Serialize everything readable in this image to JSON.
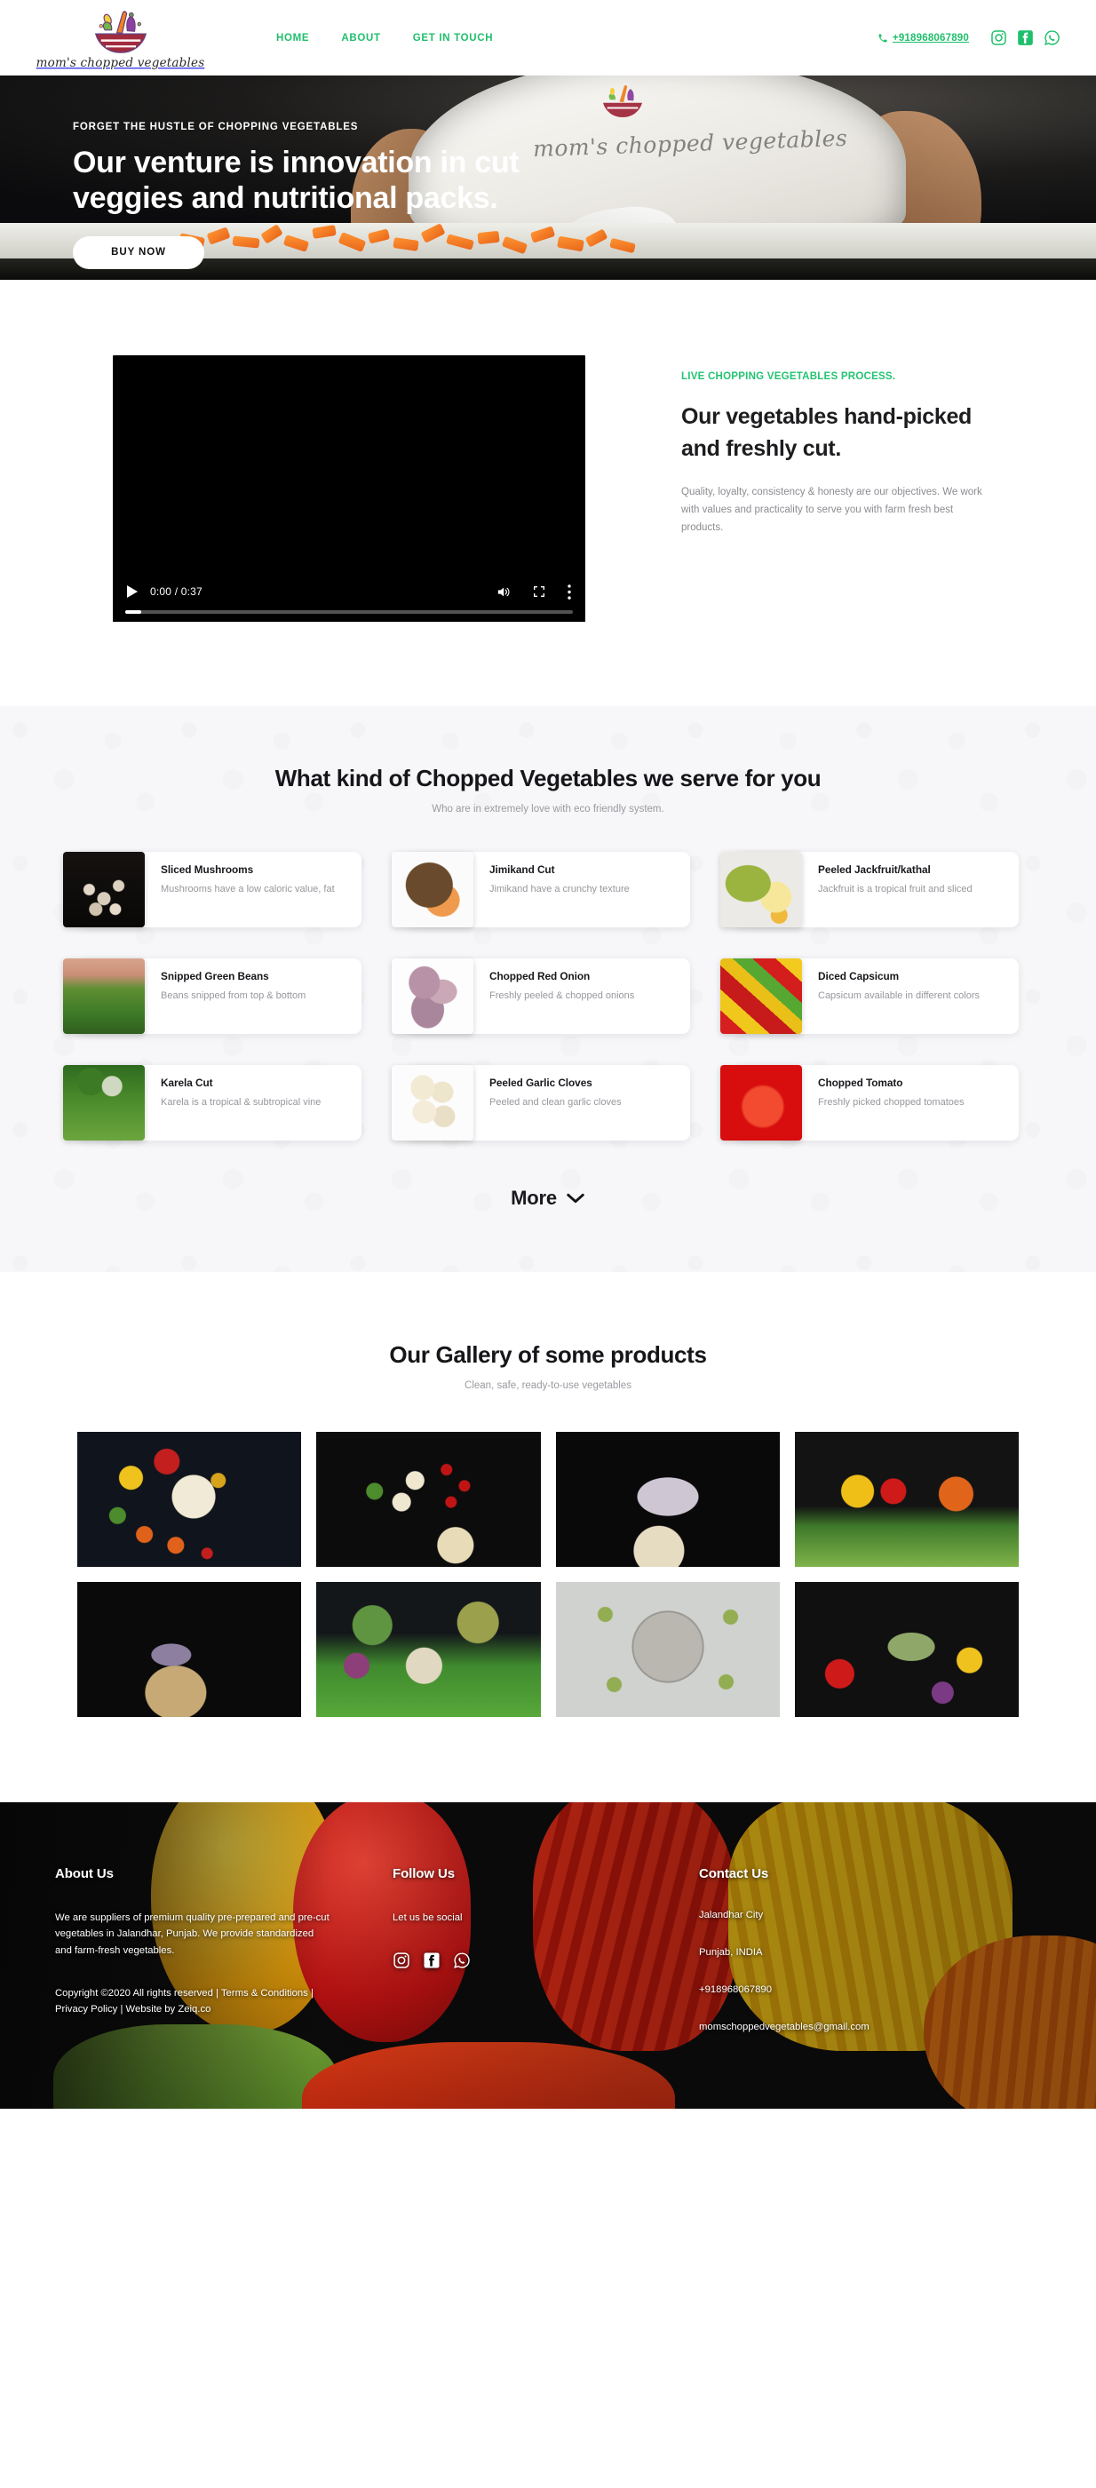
{
  "header": {
    "logo_word": "mom's chopped vegetables",
    "logo_icon": "vegetable-bowl-logo",
    "nav": [
      {
        "label": "HOME"
      },
      {
        "label": "ABOUT"
      },
      {
        "label": "GET IN TOUCH"
      }
    ],
    "phone": "+918968067890",
    "phone_icon": "phone-icon",
    "social": [
      {
        "name": "instagram-icon"
      },
      {
        "name": "facebook-icon"
      },
      {
        "name": "whatsapp-icon"
      }
    ],
    "accent_color": "#1fbf6b"
  },
  "hero": {
    "kicker": "FORGET THE HUSTLE OF CHOPPING VEGETABLES",
    "title": "Our venture is innovation in cut veggies and nutritional packs.",
    "cta": "BUY NOW",
    "shirt_print": "mom's chopped vegetables"
  },
  "video_section": {
    "eyebrow": "LIVE CHOPPING VEGETABLES PROCESS.",
    "heading": "Our vegetables hand-picked and freshly cut.",
    "paragraph": "Quality, loyalty, consistency & honesty are our objectives. We work with values and practicality to serve you with farm fresh best products.",
    "player": {
      "time": "0:00 / 0:37",
      "play_icon": "play-icon",
      "volume_icon": "volume-icon",
      "fullscreen_icon": "fullscreen-icon",
      "more-options_icon": "more-options-icon"
    }
  },
  "products": {
    "title": "What kind of Chopped Vegetables we serve for you",
    "subtitle": "Who are in extremely love with eco friendly system.",
    "more_label": "More",
    "more_icon": "chevron-down-icon",
    "cards": [
      {
        "title": "Sliced Mushrooms",
        "desc": "Mushrooms have a low caloric value, fat"
      },
      {
        "title": "Jimikand Cut",
        "desc": "Jimikand have a crunchy texture"
      },
      {
        "title": "Peeled Jackfruit/kathal",
        "desc": "Jackfruit is a tropical fruit and sliced"
      },
      {
        "title": "Snipped Green Beans",
        "desc": "Beans snipped from top & bottom"
      },
      {
        "title": "Chopped Red Onion",
        "desc": "Freshly peeled & chopped onions"
      },
      {
        "title": "Diced Capsicum",
        "desc": "Capsicum available in different colors"
      },
      {
        "title": "Karela Cut",
        "desc": "Karela is a tropical & subtropical vine"
      },
      {
        "title": "Peeled Garlic Cloves",
        "desc": "Peeled and clean garlic cloves"
      },
      {
        "title": "Chopped Tomato",
        "desc": "Freshly picked chopped tomatoes"
      }
    ]
  },
  "gallery": {
    "title": "Our Gallery of some products",
    "subtitle": "Clean, safe, ready-to-use vegetables",
    "items": [
      {
        "alt": "vegetables-flatlay-dark"
      },
      {
        "alt": "garlic-beans-tomatoes-flatlay"
      },
      {
        "alt": "packed-tray-on-black"
      },
      {
        "alt": "peppers-and-greens"
      },
      {
        "alt": "pack-with-noodles-dark"
      },
      {
        "alt": "mixed-vegetables-on-grass"
      },
      {
        "alt": "cucumber-slices-ring"
      },
      {
        "alt": "display-board-with-vegetables"
      }
    ]
  },
  "footer": {
    "about": {
      "heading": "About Us",
      "text": "We are suppliers of premium quality pre-prepared and pre-cut vegetables in Jalandhar, Punjab. We provide standardized and farm-fresh vegetables.",
      "copyright": "Copyright ©2020 All rights reserved | Terms & Conditions | Privacy Policy | Website by Zeiq.co"
    },
    "follow": {
      "heading": "Follow Us",
      "text": "Let us be social",
      "social": [
        {
          "name": "instagram-icon"
        },
        {
          "name": "facebook-icon"
        },
        {
          "name": "whatsapp-icon"
        }
      ]
    },
    "contact": {
      "heading": "Contact Us",
      "lines": [
        "Jalandhar City",
        "Punjab, INDIA",
        "+918968067890",
        "momschoppedvegetables@gmail.com"
      ]
    }
  }
}
